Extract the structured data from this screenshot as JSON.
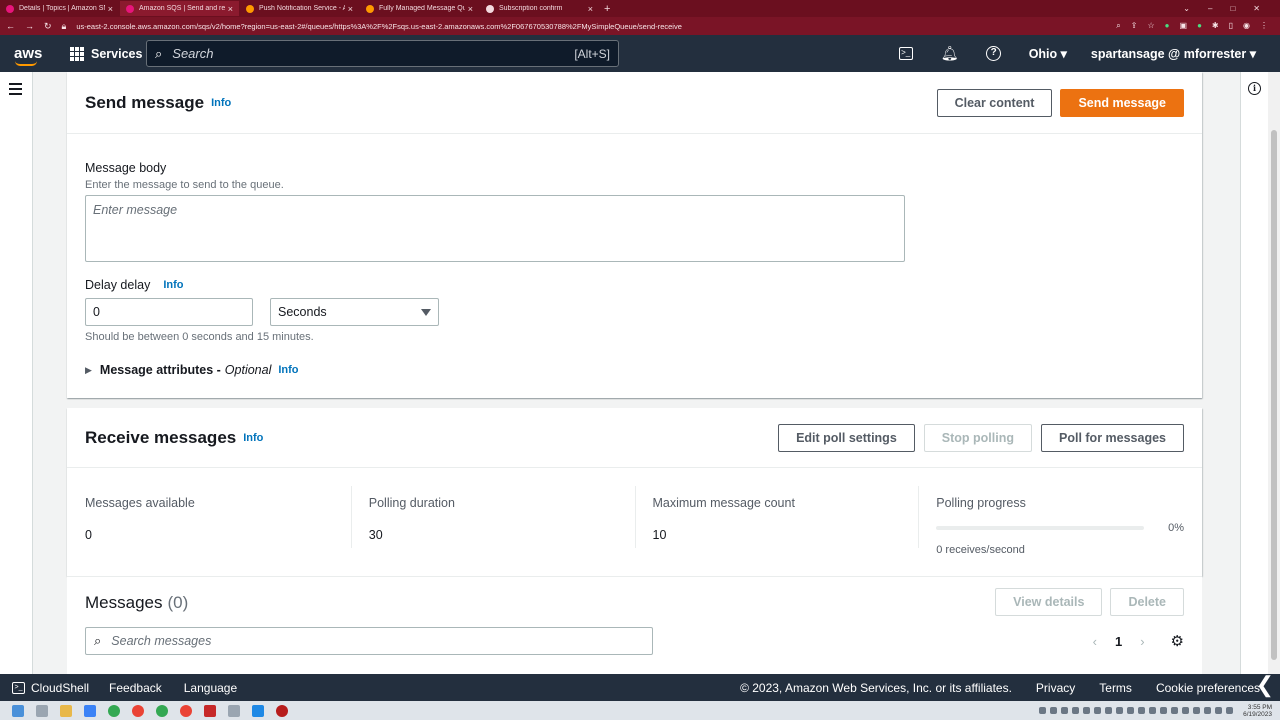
{
  "browser": {
    "tabs": [
      {
        "title": "Details | Topics | Amazon SNS",
        "color": "#e7157b",
        "active": false
      },
      {
        "title": "Amazon SQS | Send and receive",
        "color": "#e7157b",
        "active": true
      },
      {
        "title": "Push Notification Service - Amaz",
        "color": "#ff9900",
        "active": false
      },
      {
        "title": "Fully Managed Message Queue",
        "color": "#ff9900",
        "active": false
      },
      {
        "title": "Subscription confirm",
        "color": "#f3d9de",
        "active": false
      }
    ],
    "new_tab": "+",
    "url": "us-east-2.console.aws.amazon.com/sqs/v2/home?region=us-east-2#/queues/https%3A%2F%2Fsqs.us-east-2.amazonaws.com%2F067670530788%2FMySimpleQueue/send-receive"
  },
  "topnav": {
    "logo": "aws",
    "services_label": "Services",
    "search_placeholder": "Search",
    "search_shortcut": "[Alt+S]",
    "region": "Ohio",
    "user": "spartansage @ mforrester"
  },
  "send": {
    "title": "Send message",
    "info": "Info",
    "clear_label": "Clear content",
    "send_label": "Send message",
    "body_label": "Message body",
    "body_desc": "Enter the message to send to the queue.",
    "body_placeholder": "Enter message",
    "delay_label": "Delay delay",
    "delay_info": "Info",
    "delay_value": "0",
    "delay_unit": "Seconds",
    "delay_hint": "Should be between 0 seconds and 15 minutes.",
    "attributes_label": "Message attributes -",
    "attributes_optional": "Optional",
    "attributes_info": "Info"
  },
  "receive": {
    "title": "Receive messages",
    "info": "Info",
    "edit_poll_label": "Edit poll settings",
    "stop_polling_label": "Stop polling",
    "poll_label": "Poll for messages",
    "stats": [
      {
        "label": "Messages available",
        "value": "0"
      },
      {
        "label": "Polling duration",
        "value": "30"
      },
      {
        "label": "Maximum message count",
        "value": "10"
      }
    ],
    "progress_label": "Polling progress",
    "progress_pct": "0%",
    "progress_fraction": 0,
    "rate": "0 receives/second"
  },
  "messages": {
    "title": "Messages",
    "count": "(0)",
    "view_details_label": "View details",
    "delete_label": "Delete",
    "search_placeholder": "Search messages",
    "page": "1"
  },
  "footer": {
    "cloudshell": "CloudShell",
    "feedback": "Feedback",
    "language": "Language",
    "copyright": "© 2023, Amazon Web Services, Inc. or its affiliates.",
    "privacy": "Privacy",
    "terms": "Terms",
    "cookies": "Cookie preferences"
  },
  "taskbar": {
    "time": "3:55 PM",
    "date": "6/19/2023"
  },
  "colors": {
    "primary": "#ec7211",
    "link": "#0073bb",
    "nav": "#232f3e"
  }
}
